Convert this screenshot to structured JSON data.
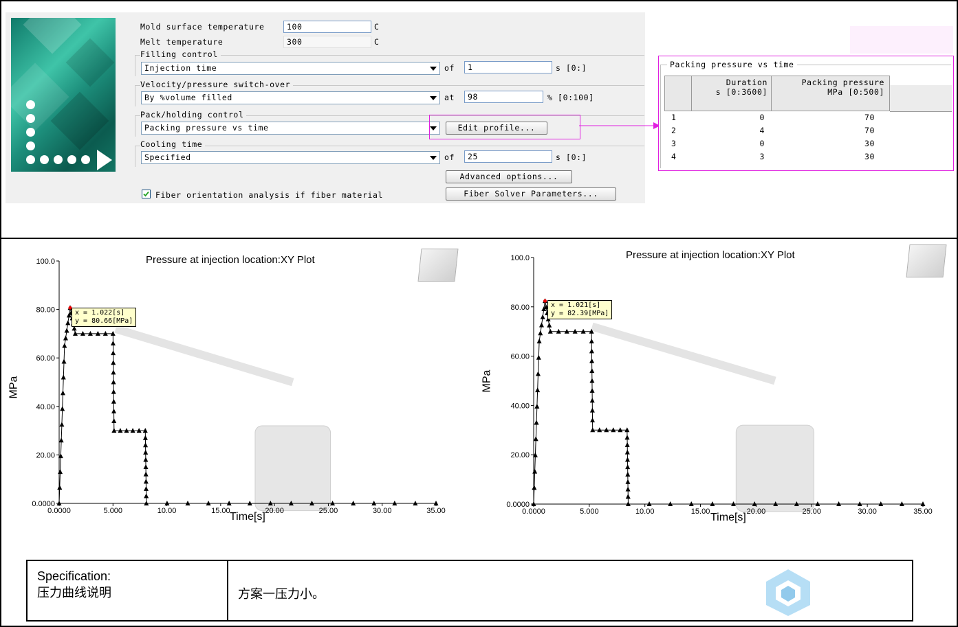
{
  "dialog": {
    "mold_surface_temp_label": "Mold surface temperature",
    "mold_surface_temp_value": "100",
    "mold_surface_temp_unit": "C",
    "melt_temp_label": "Melt temperature",
    "melt_temp_value": "300",
    "melt_temp_unit": "C",
    "filling_control_label": "Filling control",
    "filling_control_value": "Injection time",
    "filling_of_label": "of",
    "filling_of_value": "1",
    "filling_unit": "s [0:]",
    "switchover_label": "Velocity/pressure switch-over",
    "switchover_value": "By %volume filled",
    "switchover_at_label": "at",
    "switchover_at_value": "98",
    "switchover_unit": "% [0:100]",
    "pack_label": "Pack/holding control",
    "pack_value": "Packing pressure vs time",
    "edit_profile_button": "Edit profile...",
    "cooling_label": "Cooling time",
    "cooling_value": "Specified",
    "cooling_of_label": "of",
    "cooling_of_value": "25",
    "cooling_unit": "s [0:]",
    "advanced_button": "Advanced options...",
    "fiber_solver_button": "Fiber Solver Parameters...",
    "fiber_checkbox_label": "Fiber orientation analysis if fiber material"
  },
  "profile_table": {
    "title": "Packing pressure vs time",
    "col1_line1": "Duration",
    "col1_line2": "s [0:3600]",
    "col2_line1": "Packing pressure",
    "col2_line2": "MPa [0:500]",
    "rows": [
      {
        "idx": "1",
        "duration": "0",
        "pressure": "70"
      },
      {
        "idx": "2",
        "duration": "4",
        "pressure": "70"
      },
      {
        "idx": "3",
        "duration": "0",
        "pressure": "30"
      },
      {
        "idx": "4",
        "duration": "3",
        "pressure": "30"
      }
    ]
  },
  "plot_left": {
    "title": "Pressure at injection location:XY Plot",
    "ylabel": "MPa",
    "xlabel": "Time[s]",
    "yticks": [
      "100.0",
      "80.00",
      "60.00",
      "40.00",
      "20.00",
      "0.0000"
    ],
    "xticks": [
      "0.0000",
      "5.000",
      "10.00",
      "15.00",
      "20.00",
      "25.00",
      "30.00",
      "35.00"
    ],
    "tooltip_x": "x = 1.022[s]",
    "tooltip_y": "y = 80.66[MPa]"
  },
  "plot_right": {
    "title": "Pressure at injection location:XY Plot",
    "ylabel": "MPa",
    "xlabel": "Time[s]",
    "yticks": [
      "100.0",
      "80.00",
      "60.00",
      "40.00",
      "20.00",
      "0.0000"
    ],
    "xticks": [
      "0.0000",
      "5.000",
      "10.00",
      "15.00",
      "20.00",
      "25.00",
      "30.00",
      "35.00"
    ],
    "tooltip_x": "x = 1.021[s]",
    "tooltip_y": "y = 82.39[MPa]"
  },
  "spec": {
    "label_line1": "Specification:",
    "label_line2": "压力曲线说明",
    "value": "方案一压力小。"
  },
  "chart_data": [
    {
      "type": "line",
      "title": "Pressure at injection location:XY Plot",
      "xlabel": "Time[s]",
      "ylabel": "MPa",
      "xlim": [
        0,
        35
      ],
      "ylim": [
        0,
        100
      ],
      "x": [
        0,
        0.5,
        1.022,
        1.5,
        5,
        5.1,
        8,
        8.1,
        35
      ],
      "y": [
        0,
        65,
        80.66,
        70,
        70,
        30,
        30,
        0,
        0
      ]
    },
    {
      "type": "line",
      "title": "Pressure at injection location:XY Plot",
      "xlabel": "Time[s]",
      "ylabel": "MPa",
      "xlim": [
        0,
        35
      ],
      "ylim": [
        0,
        100
      ],
      "x": [
        0,
        0.5,
        1.021,
        1.5,
        5.2,
        5.3,
        8.4,
        8.5,
        35
      ],
      "y": [
        0,
        66,
        82.39,
        70,
        70,
        30,
        30,
        0,
        0
      ]
    }
  ]
}
